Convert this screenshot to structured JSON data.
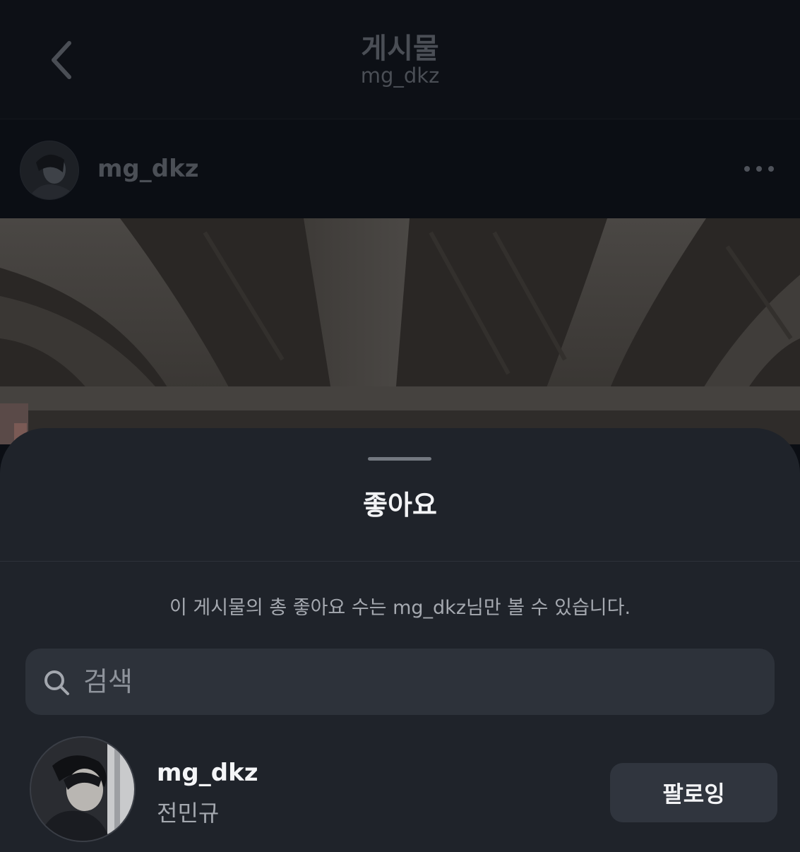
{
  "header": {
    "title": "게시물",
    "subtitle": "mg_dkz"
  },
  "post": {
    "username": "mg_dkz"
  },
  "likes_sheet": {
    "title": "좋아요",
    "notice": "이 게시물의 총 좋아요 수는 mg_dkz님만 볼 수 있습니다.",
    "search_placeholder": "검색",
    "likers": [
      {
        "username": "mg_dkz",
        "full_name": "전민규",
        "button_label": "팔로잉"
      }
    ]
  },
  "colors": {
    "background": "#0b0e14",
    "sheet": "#1f232a",
    "search_field": "#2d323a",
    "follow_button": "#30353e",
    "primary_text": "#f2f3f5",
    "secondary_text": "#a5a9b0"
  }
}
